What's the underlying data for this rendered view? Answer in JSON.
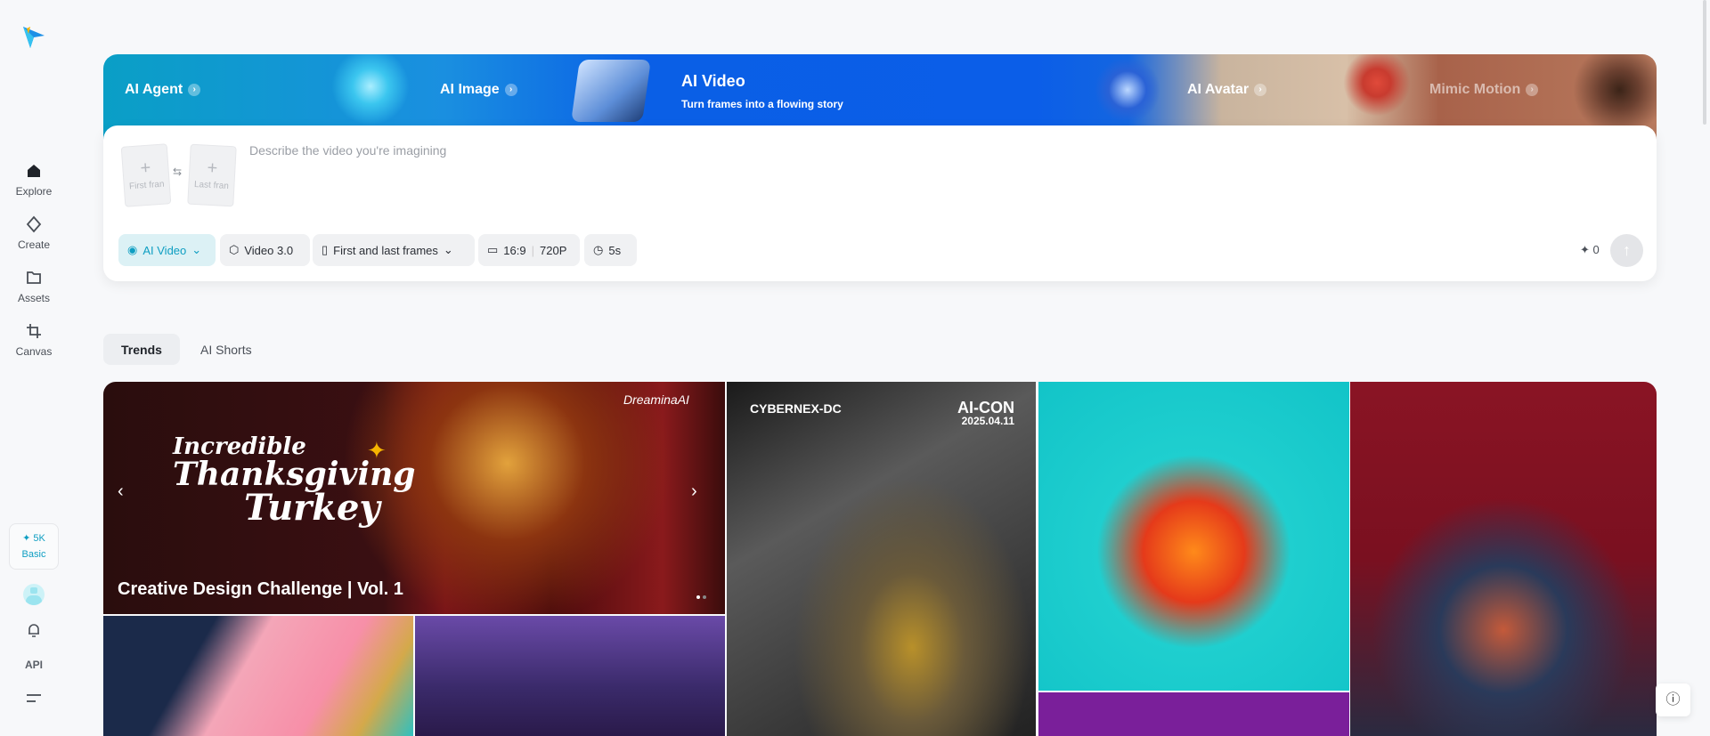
{
  "sidebar": {
    "items": [
      {
        "label": "Explore",
        "icon": "home-icon"
      },
      {
        "label": "Create",
        "icon": "diamond-icon"
      },
      {
        "label": "Assets",
        "icon": "folder-icon"
      },
      {
        "label": "Canvas",
        "icon": "crop-icon"
      }
    ],
    "credits": {
      "amount": "5K",
      "plan": "Basic"
    },
    "api_label": "API"
  },
  "banner": {
    "items": [
      {
        "label": "AI Agent"
      },
      {
        "label": "AI Image"
      },
      {
        "label": "AI Video",
        "subtitle": "Turn frames into a flowing story"
      },
      {
        "label": "AI Avatar"
      },
      {
        "label": "Mimic Motion"
      }
    ]
  },
  "prompt": {
    "placeholder": "Describe the video you're imagining",
    "first_frame": "First fran",
    "last_frame": "Last fran",
    "toolbar": {
      "mode": "AI Video",
      "model": "Video 3.0",
      "frames": "First and last frames",
      "ratio": "16:9",
      "resolution": "720P",
      "duration": "5s",
      "credits": "0"
    }
  },
  "tabs": [
    {
      "label": "Trends",
      "active": true
    },
    {
      "label": "AI Shorts",
      "active": false
    }
  ],
  "gallery": {
    "featured": {
      "title": "Creative Design Challenge | Vol. 1",
      "art_line1": "Incredible",
      "art_line2": "Thanksgiving",
      "art_line3": "Turkey",
      "brand": "DreaminaAI"
    },
    "tile2": {
      "brand": "CYBERNEX-DC",
      "event": "AI-CON",
      "date": "2025.04.11"
    }
  },
  "colors": {
    "accent": "#0ea5c6",
    "page_bg": "#f7f8fa"
  }
}
